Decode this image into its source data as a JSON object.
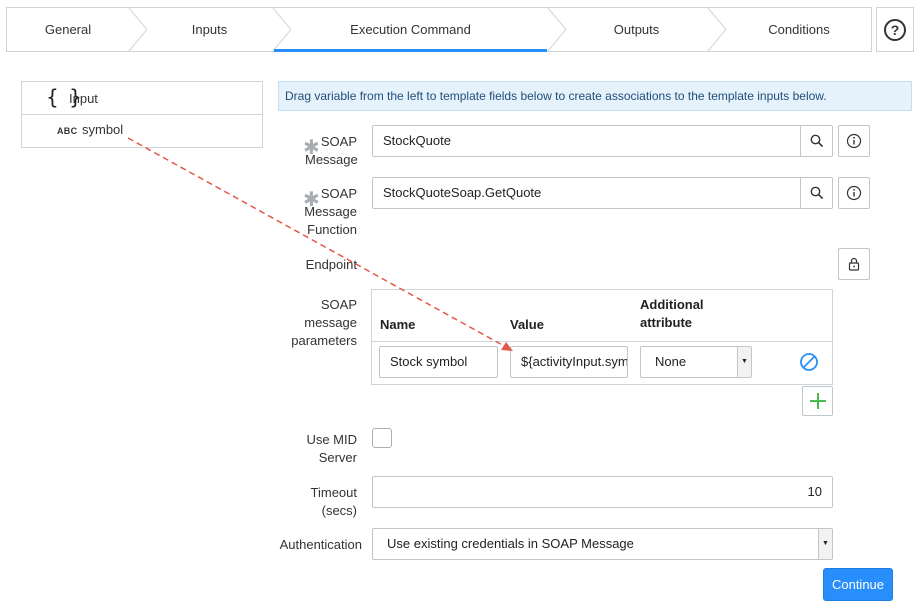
{
  "steps": {
    "general": "General",
    "inputs": "Inputs",
    "execution_command": "Execution Command",
    "outputs": "Outputs",
    "conditions": "Conditions"
  },
  "help_icon": "question-circle-icon",
  "variables": {
    "root_label": "Input",
    "root_icon": "braces-icon",
    "item_type": "ABC",
    "item_label": "symbol"
  },
  "banner": "Drag variable from the left to template fields below to create associations to the template inputs below.",
  "form": {
    "soap_message": {
      "label_lines": [
        "SOAP",
        "Message"
      ],
      "value": "StockQuote",
      "required": true
    },
    "soap_message_function": {
      "label_lines": [
        "SOAP",
        "Message",
        "Function"
      ],
      "value": "StockQuoteSoap.GetQuote",
      "required": true
    },
    "endpoint": {
      "label": "Endpoint",
      "lock_icon": "lock-icon"
    },
    "soap_message_parameters": {
      "label_lines": [
        "SOAP",
        "message",
        "parameters"
      ],
      "columns": {
        "name": "Name",
        "value": "Value",
        "additional_line1": "Additional",
        "additional_line2": "attribute"
      },
      "rows": [
        {
          "name": "Stock symbol",
          "value": "${activityInput.sym",
          "attribute": "None"
        }
      ]
    },
    "use_mid_server": {
      "label_lines": [
        "Use MID",
        "Server"
      ],
      "checked": false
    },
    "timeout": {
      "label_lines": [
        "Timeout",
        "(secs)"
      ],
      "value": "10"
    },
    "authentication": {
      "label": "Authentication",
      "selected": "Use existing credentials in SOAP Message"
    }
  },
  "continue_label": "Continue",
  "colors": {
    "accent": "#278efc",
    "drag_line": "#e4584a",
    "add_green": "#4cbb4c",
    "banner_bg": "#e5f1fb"
  }
}
